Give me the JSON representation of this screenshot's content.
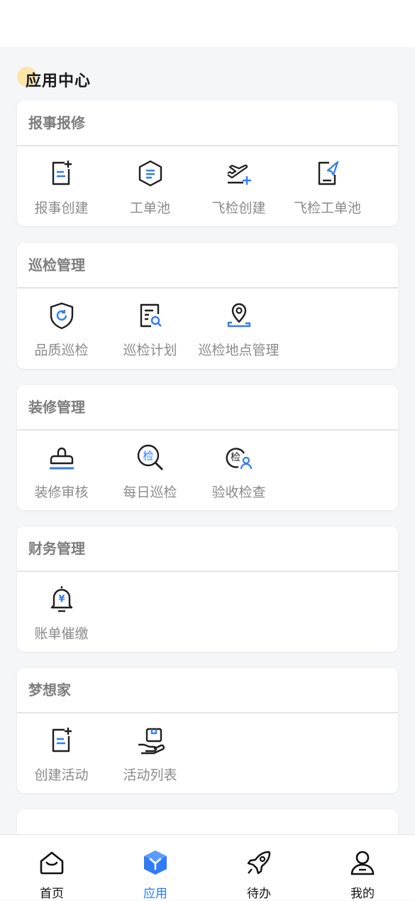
{
  "page": {
    "title": "应用中心"
  },
  "sections": [
    {
      "title": "报事报修",
      "items": [
        {
          "label": "报事创建",
          "icon": "doc-plus-icon"
        },
        {
          "label": "工单池",
          "icon": "hexagon-list-icon"
        },
        {
          "label": "飞检创建",
          "icon": "plane-plus-icon"
        },
        {
          "label": "飞检工单池",
          "icon": "doc-send-icon"
        }
      ]
    },
    {
      "title": "巡检管理",
      "items": [
        {
          "label": "品质巡检",
          "icon": "shield-refresh-icon"
        },
        {
          "label": "巡检计划",
          "icon": "doc-search-icon"
        },
        {
          "label": "巡检地点管理",
          "icon": "location-pin-icon"
        }
      ]
    },
    {
      "title": "装修管理",
      "items": [
        {
          "label": "装修审核",
          "icon": "stamp-icon"
        },
        {
          "label": "每日巡检",
          "icon": "magnifier-check-icon",
          "glyph": "检"
        },
        {
          "label": "验收检查",
          "icon": "check-person-icon",
          "glyph": "检"
        }
      ]
    },
    {
      "title": "财务管理",
      "items": [
        {
          "label": "账单催缴",
          "icon": "bell-yen-icon",
          "glyph": "¥"
        }
      ]
    },
    {
      "title": "梦想家",
      "items": [
        {
          "label": "创建活动",
          "icon": "doc-plus-icon"
        },
        {
          "label": "活动列表",
          "icon": "hand-box-icon"
        }
      ]
    }
  ],
  "tabbar": [
    {
      "label": "首页",
      "icon": "home-icon"
    },
    {
      "label": "应用",
      "icon": "apps-cube-icon"
    },
    {
      "label": "待办",
      "icon": "rocket-icon"
    },
    {
      "label": "我的",
      "icon": "profile-icon"
    }
  ],
  "colors": {
    "accent": "#2f7cf6",
    "icon_dark": "#1f1f1f",
    "label_gray": "#8a8a8a",
    "header_dot": "#fde4a8"
  }
}
